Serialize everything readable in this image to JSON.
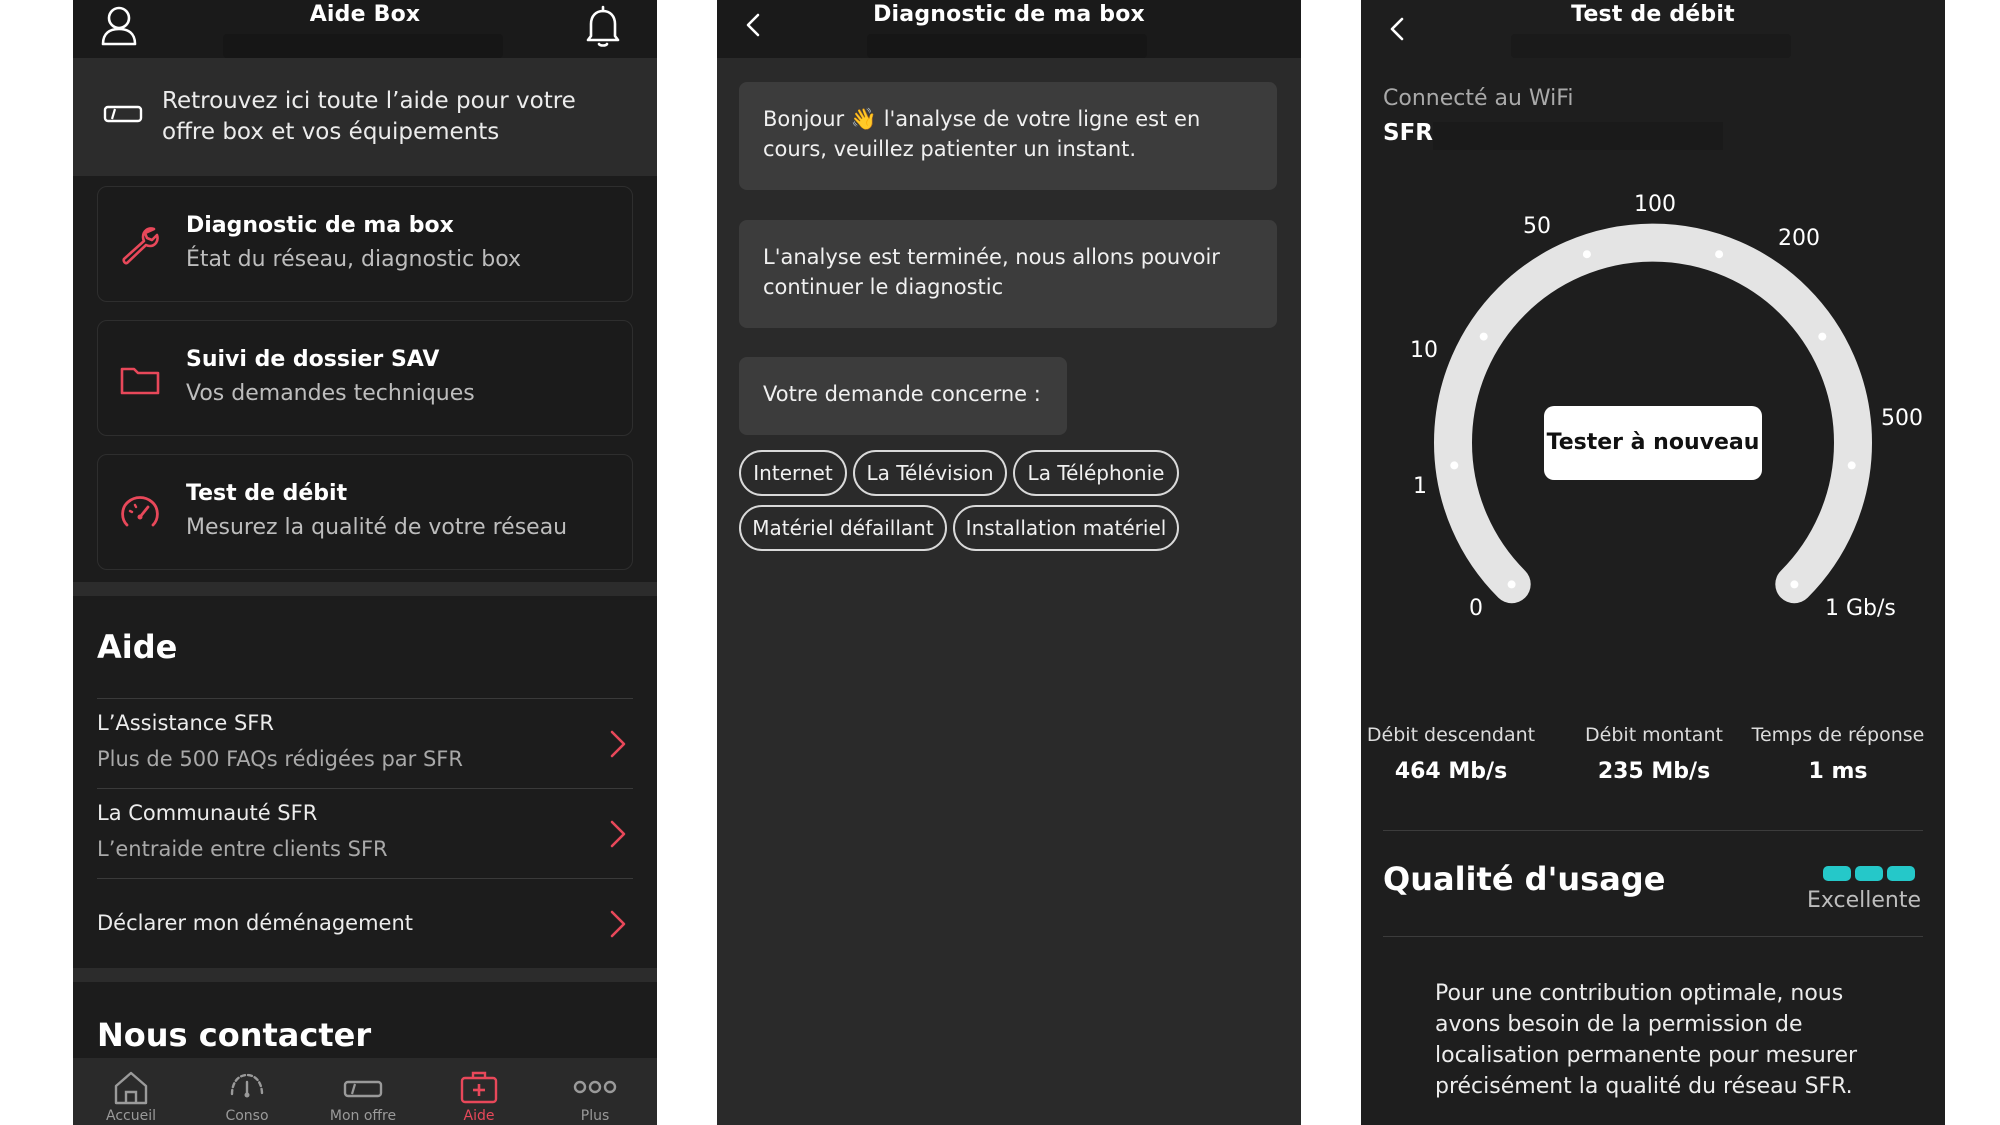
{
  "colors": {
    "accent_red": "#e8485a",
    "quality_teal": "#25c8c9",
    "bg_dark": "#1c1c1c"
  },
  "screen1": {
    "title": "Aide Box",
    "hero_text": "Retrouvez ici toute l’aide pour votre offre box et vos équipements",
    "cards": [
      {
        "title": "Diagnostic de ma box",
        "subtitle": "État du réseau, diagnostic box",
        "icon": "wrench-icon"
      },
      {
        "title": "Suivi de dossier SAV",
        "subtitle": "Vos demandes techniques",
        "icon": "folder-icon"
      },
      {
        "title": "Test de débit",
        "subtitle": "Mesurez la qualité de votre réseau",
        "icon": "speedometer-icon"
      }
    ],
    "aide_title": "Aide",
    "aide_rows": [
      {
        "title": "L’Assistance SFR",
        "subtitle": "Plus de 500 FAQs rédigées par SFR"
      },
      {
        "title": "La Communauté SFR",
        "subtitle": "L’entraide entre clients SFR"
      },
      {
        "title": "Déclarer mon déménagement",
        "subtitle": ""
      }
    ],
    "contact_title": "Nous contacter",
    "tabs": [
      {
        "label": "Accueil",
        "icon": "home-icon",
        "active": false
      },
      {
        "label": "Conso",
        "icon": "gauge-icon",
        "active": false
      },
      {
        "label": "Mon offre",
        "icon": "box-icon",
        "active": false
      },
      {
        "label": "Aide",
        "icon": "medkit-icon",
        "active": true
      },
      {
        "label": "Plus",
        "icon": "more-icon",
        "active": false
      }
    ]
  },
  "screen2": {
    "title": "Diagnostic de ma box",
    "messages": [
      "Bonjour 👋 l'analyse de votre ligne est en cours, veuillez patienter un instant.",
      "L'analyse est terminée, nous allons pouvoir continuer le diagnostic",
      "Votre demande concerne :"
    ],
    "chips": [
      "Internet",
      "La Télévision",
      "La Téléphonie",
      "Matériel défaillant",
      "Installation matériel"
    ]
  },
  "screen3": {
    "title": "Test de débit",
    "wifi_label": "Connecté au WiFi",
    "wifi_name": "SFR",
    "gauge_labels": [
      "0",
      "1",
      "10",
      "50",
      "100",
      "200",
      "500",
      "1 Gb/s"
    ],
    "retest_label": "Tester à nouveau",
    "stats": [
      {
        "label": "Débit descendant",
        "value": "464 Mb/s"
      },
      {
        "label": "Débit montant",
        "value": "235 Mb/s"
      },
      {
        "label": "Temps de réponse",
        "value": "1 ms"
      }
    ],
    "quality_title": "Qualité d'usage",
    "quality_value": "Excellente",
    "quality_level": 3,
    "quality_max": 3,
    "permission_text": "Pour une contribution optimale, nous avons besoin de la permission de localisation permanente pour mesurer précisément la qualité du réseau SFR."
  }
}
